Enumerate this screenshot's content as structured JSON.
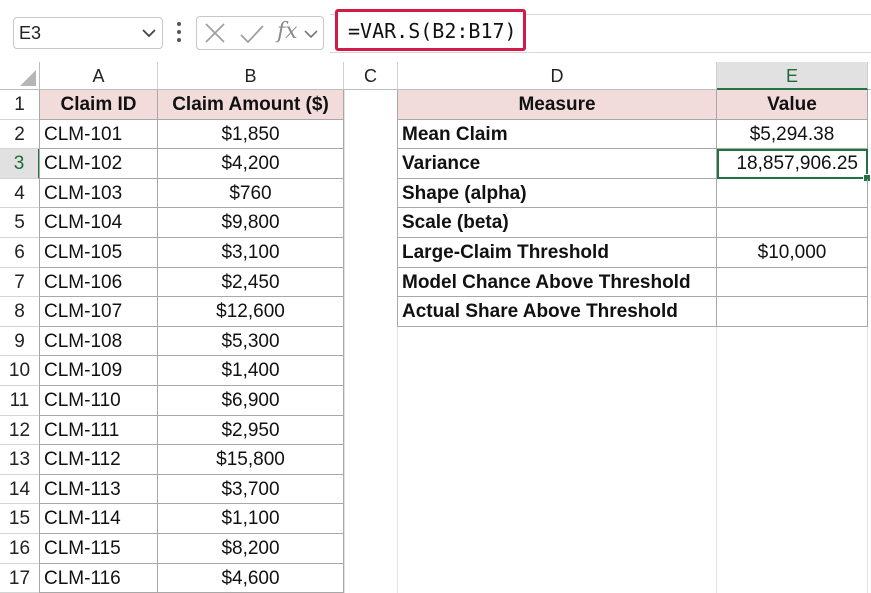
{
  "formula_bar": {
    "name_box": "E3",
    "fx_label": "fx",
    "formula": "=VAR.S(B2:B17)"
  },
  "columns": [
    "A",
    "B",
    "C",
    "D",
    "E"
  ],
  "rows": [
    "1",
    "2",
    "3",
    "4",
    "5",
    "6",
    "7",
    "8",
    "9",
    "10",
    "11",
    "12",
    "13",
    "14",
    "15",
    "16",
    "17"
  ],
  "claims": {
    "header_id": "Claim ID",
    "header_amount": "Claim Amount ($)",
    "items": [
      {
        "id": "CLM-101",
        "amount": "$1,850"
      },
      {
        "id": "CLM-102",
        "amount": "$4,200"
      },
      {
        "id": "CLM-103",
        "amount": "$760"
      },
      {
        "id": "CLM-104",
        "amount": "$9,800"
      },
      {
        "id": "CLM-105",
        "amount": "$3,100"
      },
      {
        "id": "CLM-106",
        "amount": "$2,450"
      },
      {
        "id": "CLM-107",
        "amount": "$12,600"
      },
      {
        "id": "CLM-108",
        "amount": "$5,300"
      },
      {
        "id": "CLM-109",
        "amount": "$1,400"
      },
      {
        "id": "CLM-110",
        "amount": "$6,900"
      },
      {
        "id": "CLM-111",
        "amount": "$2,950"
      },
      {
        "id": "CLM-112",
        "amount": "$15,800"
      },
      {
        "id": "CLM-113",
        "amount": "$3,700"
      },
      {
        "id": "CLM-114",
        "amount": "$1,100"
      },
      {
        "id": "CLM-115",
        "amount": "$8,200"
      },
      {
        "id": "CLM-116",
        "amount": "$4,600"
      }
    ]
  },
  "measures": {
    "header_measure": "Measure",
    "header_value": "Value",
    "items": [
      {
        "measure": "Mean Claim",
        "value": "$5,294.38"
      },
      {
        "measure": "Variance",
        "value": "18,857,906.25"
      },
      {
        "measure": "Shape (alpha)",
        "value": ""
      },
      {
        "measure": "Scale (beta)",
        "value": ""
      },
      {
        "measure": "Large-Claim Threshold",
        "value": "$10,000"
      },
      {
        "measure": "Model Chance Above Threshold",
        "value": ""
      },
      {
        "measure": "Actual Share Above Threshold",
        "value": ""
      }
    ]
  },
  "selection": {
    "column": "E",
    "row": "3"
  },
  "colors": {
    "accent": "#217346",
    "header_fill": "#f2dcdb",
    "formula_highlight": "#d11a47"
  }
}
